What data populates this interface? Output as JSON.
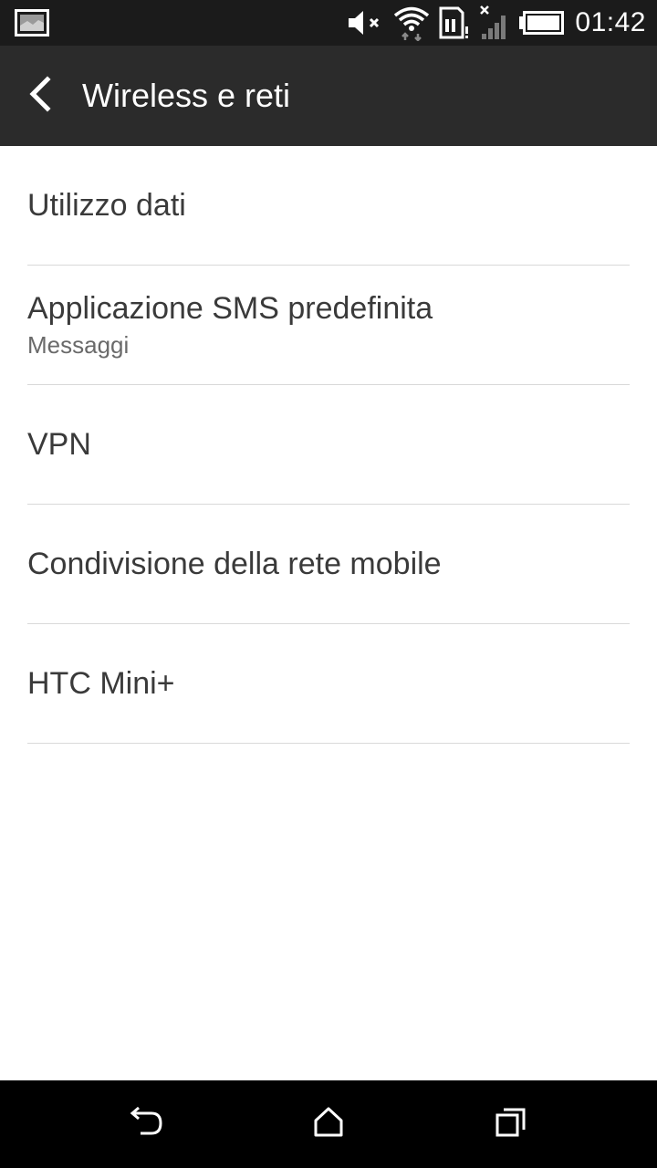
{
  "status_bar": {
    "time": "01:42",
    "icons": [
      "gallery-notification-icon",
      "mute-icon",
      "wifi-icon",
      "sim-alert-icon",
      "no-signal-icon",
      "battery-icon"
    ]
  },
  "action_bar": {
    "title": "Wireless e reti",
    "back_icon": "back-arrow-icon"
  },
  "items": [
    {
      "title": "Utilizzo dati",
      "subtitle": ""
    },
    {
      "title": "Applicazione SMS predefinita",
      "subtitle": "Messaggi"
    },
    {
      "title": "VPN",
      "subtitle": ""
    },
    {
      "title": "Condivisione della rete mobile",
      "subtitle": ""
    },
    {
      "title": "HTC Mini+",
      "subtitle": ""
    }
  ],
  "nav_bar": {
    "buttons": [
      "back-icon",
      "home-icon",
      "recents-icon"
    ]
  },
  "colors": {
    "status_bar": "#1b1b1b",
    "action_bar": "#2b2b2b",
    "background": "#ffffff",
    "divider": "#d9d9d9",
    "nav_bar": "#000000"
  }
}
